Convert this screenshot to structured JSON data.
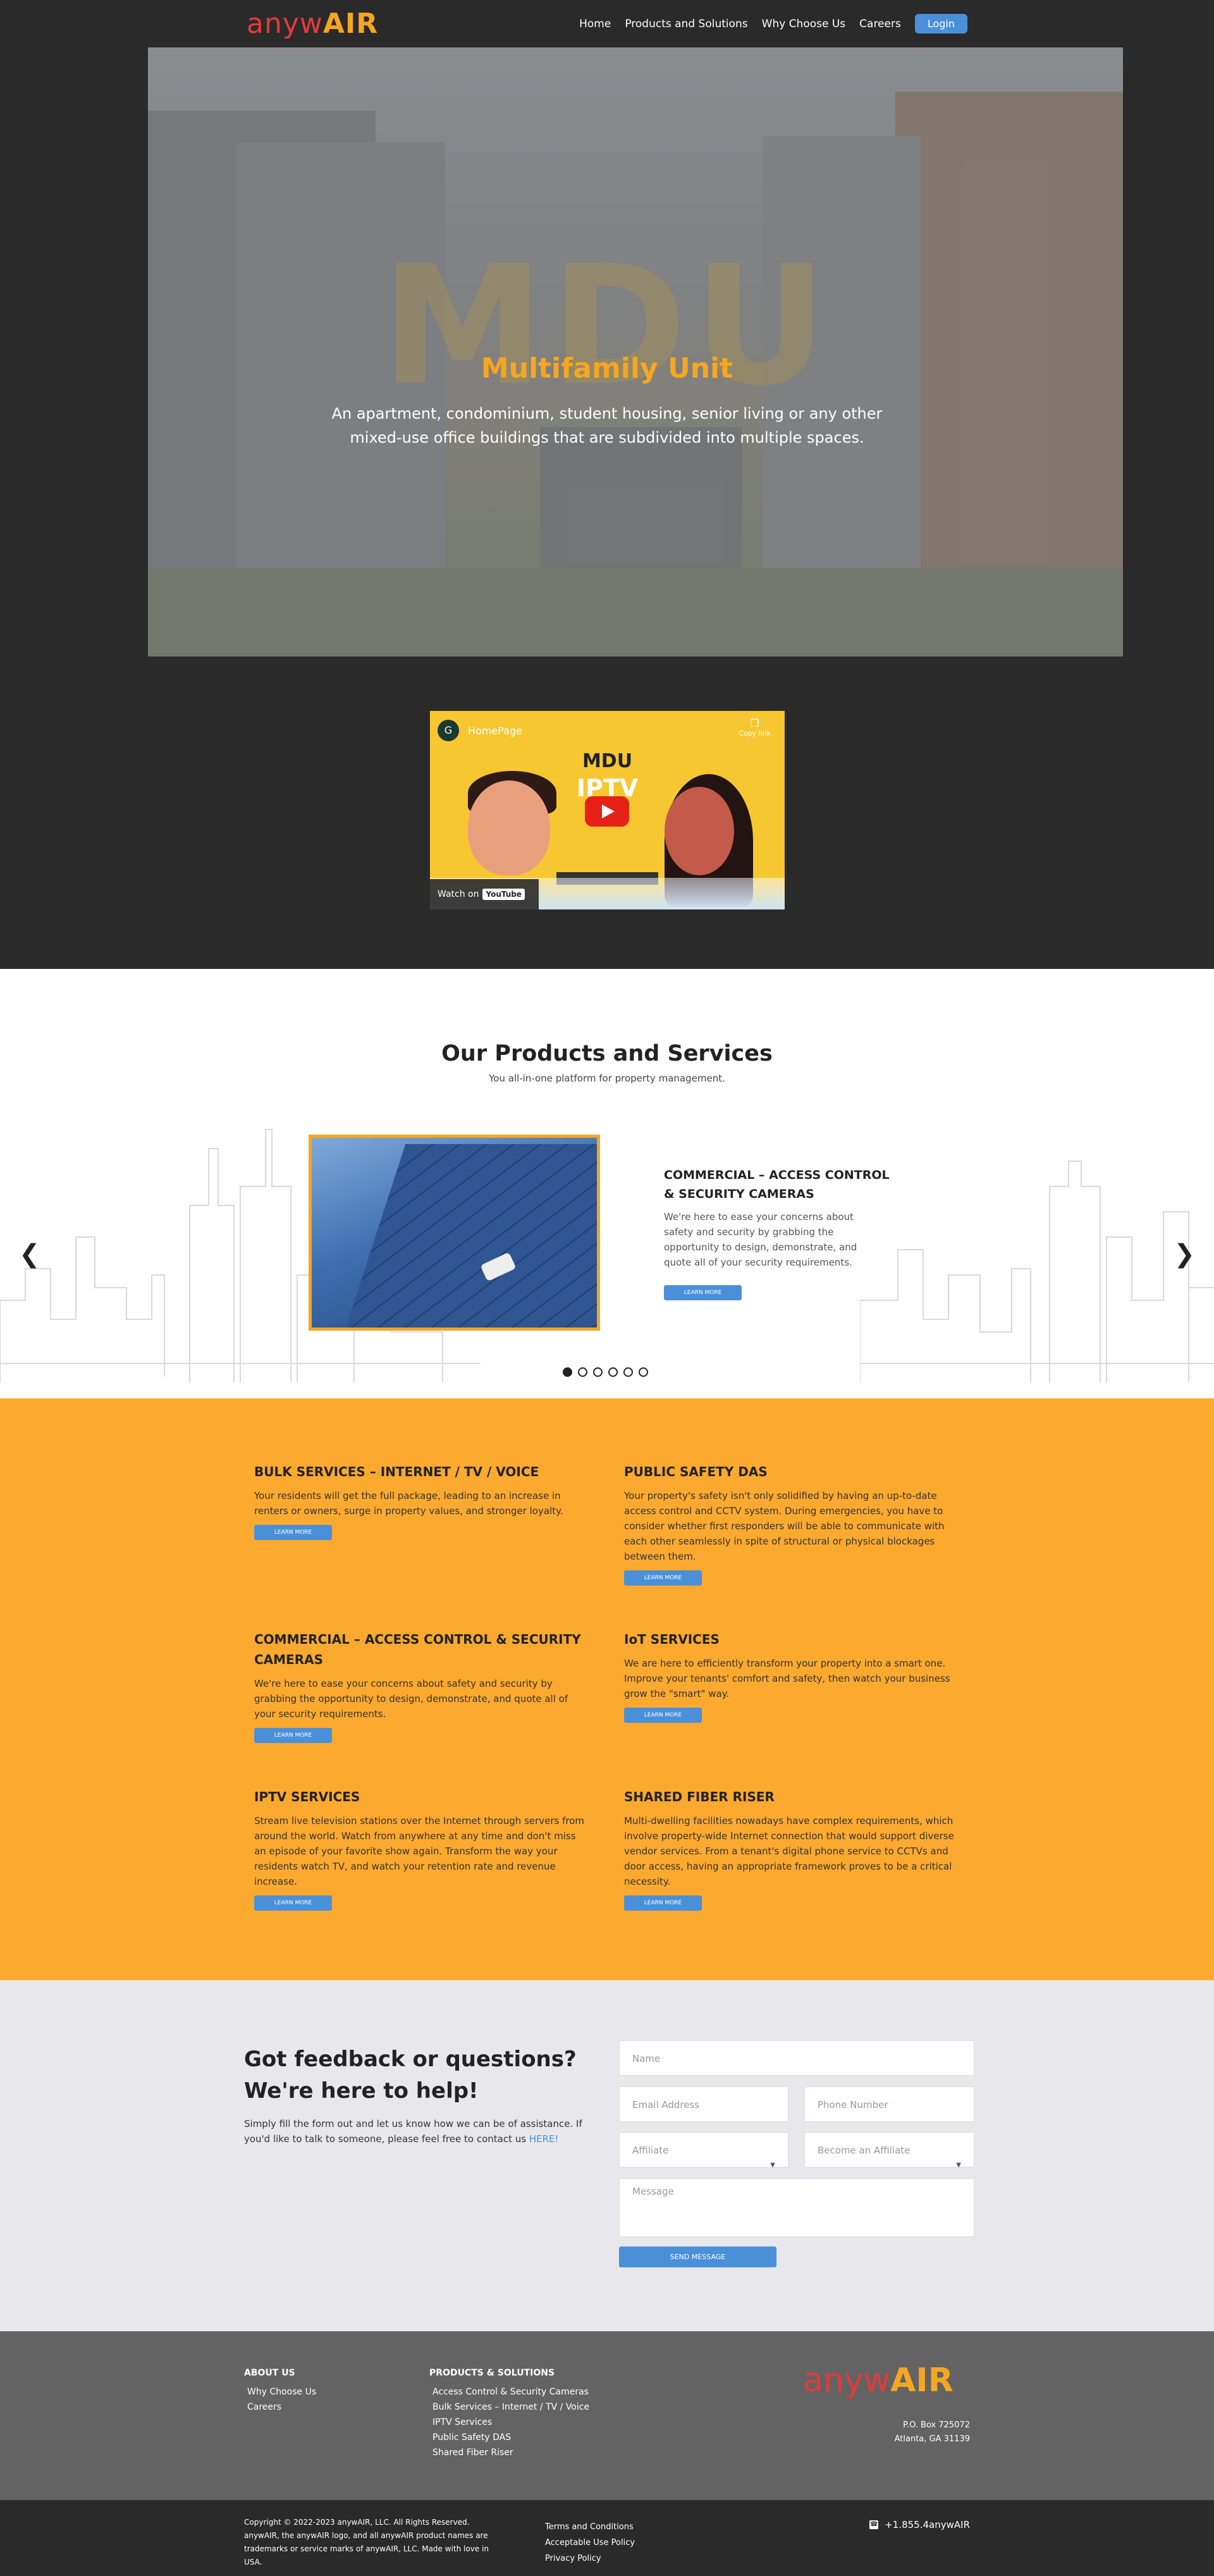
{
  "header": {
    "logo_prefix": "anyw",
    "logo_suffix": "AIR",
    "nav": [
      "Home",
      "Products and Solutions",
      "Why Choose Us",
      "Careers"
    ],
    "login": "Login"
  },
  "hero": {
    "watermark": "MDU",
    "title": "Multifamily Unit",
    "subtitle": "An apartment, condominium, student housing, senior living or any other mixed-use office buildings that are subdivided into multiple spaces."
  },
  "video": {
    "channel_initial": "G",
    "title": "HomePage",
    "copy_link": "Copy link",
    "brand": "MDU",
    "label": "IPTV",
    "watch_on": "Watch on",
    "youtube": "YouTube"
  },
  "products": {
    "title": "Our Products and Services",
    "subtitle": "You all-in-one platform for property management.",
    "slide": {
      "heading": "COMMERCIAL – ACCESS CONTROL & SECURITY CAMERAS",
      "text": "We're here to ease your concerns about safety and security by grabbing the opportunity to design, demonstrate, and quote all of your security requirements.",
      "button": "LEARN MORE"
    },
    "dots_count": 6,
    "active_dot": 0
  },
  "services": [
    {
      "title": "BULK SERVICES – INTERNET / TV / VOICE",
      "text": "Your residents will get the full package, leading to an increase in renters or owners, surge in property values, and stronger loyalty.",
      "button": "LEARN MORE"
    },
    {
      "title": "PUBLIC SAFETY DAS",
      "text": "Your property's safety isn't only solidified by having an up-to-date access control and CCTV system. During emergencies, you have to consider whether first responders will be able to communicate with each other seamlessly in spite of structural or physical blockages between them.",
      "button": "LEARN MORE"
    },
    {
      "title": "COMMERCIAL – ACCESS CONTROL & SECURITY CAMERAS",
      "text": "We're here to ease your concerns about safety and security by grabbing the opportunity to design, demonstrate, and quote all of your security requirements.",
      "button": "LEARN MORE"
    },
    {
      "title": "IoT SERVICES",
      "text": "We are here to efficiently transform your property into a smart one. Improve your tenants' comfort and safety, then watch your business grow the \"smart\" way.",
      "button": "LEARN MORE"
    },
    {
      "title": "IPTV SERVICES",
      "text": "Stream live television stations over the Internet through servers from around the world. Watch from anywhere at any time and don't miss an episode of your favorite show again. Transform the way your residents watch TV, and watch your retention rate and revenue increase.",
      "button": "LEARN MORE"
    },
    {
      "title": "SHARED FIBER RISER",
      "text": "Multi-dwelling facilities nowadays have complex requirements, which involve property-wide Internet connection that would support diverse vendor services. From a tenant's digital phone service to CCTVs and door access, having an appropriate framework proves to be a critical necessity.",
      "button": "LEARN MORE"
    }
  ],
  "contact": {
    "heading_line1": "Got feedback or questions?",
    "heading_line2": "We're here to help!",
    "text": "Simply fill the form out and let us know how we can be of assistance. If you'd like to talk to someone, please feel free to contact us",
    "link": "HERE!",
    "name_placeholder": "Name",
    "email_placeholder": "Email Address",
    "phone_placeholder": "Phone Number",
    "select1": "Affiliate",
    "select2": "Become an Affiliate",
    "message_placeholder": "Message",
    "send": "SEND MESSAGE"
  },
  "footer": {
    "about_title": "ABOUT US",
    "about_links": [
      "Why Choose Us",
      "Careers"
    ],
    "products_title": "PRODUCTS & SOLUTIONS",
    "products_links": [
      "Access Control & Security Cameras",
      "Bulk Services – Internet / TV / Voice",
      "IPTV Services",
      "Public Safety DAS",
      "Shared Fiber Riser"
    ],
    "logo_prefix": "anyw",
    "logo_suffix": "AIR",
    "address_line1": "P.O. Box 725072",
    "address_line2": "Atlanta, GA 31139"
  },
  "bottom": {
    "copyright": "Copyright © 2022-2023 anywAIR, LLC. All Rights Reserved. anywAIR, the anywAIR logo, and all anywAIR product names are trademarks or service marks of anywAIR, LLC. Made with love in USA.",
    "links": [
      "Terms and Conditions",
      "Acceptable Use Policy",
      "Privacy Policy"
    ],
    "phone": "+1.855.4anywAIR"
  },
  "colors": {
    "accent": "#f5a623",
    "brand_red": "#e23b3b",
    "button_blue": "#4a90d9",
    "dark": "#2a2a2a"
  }
}
